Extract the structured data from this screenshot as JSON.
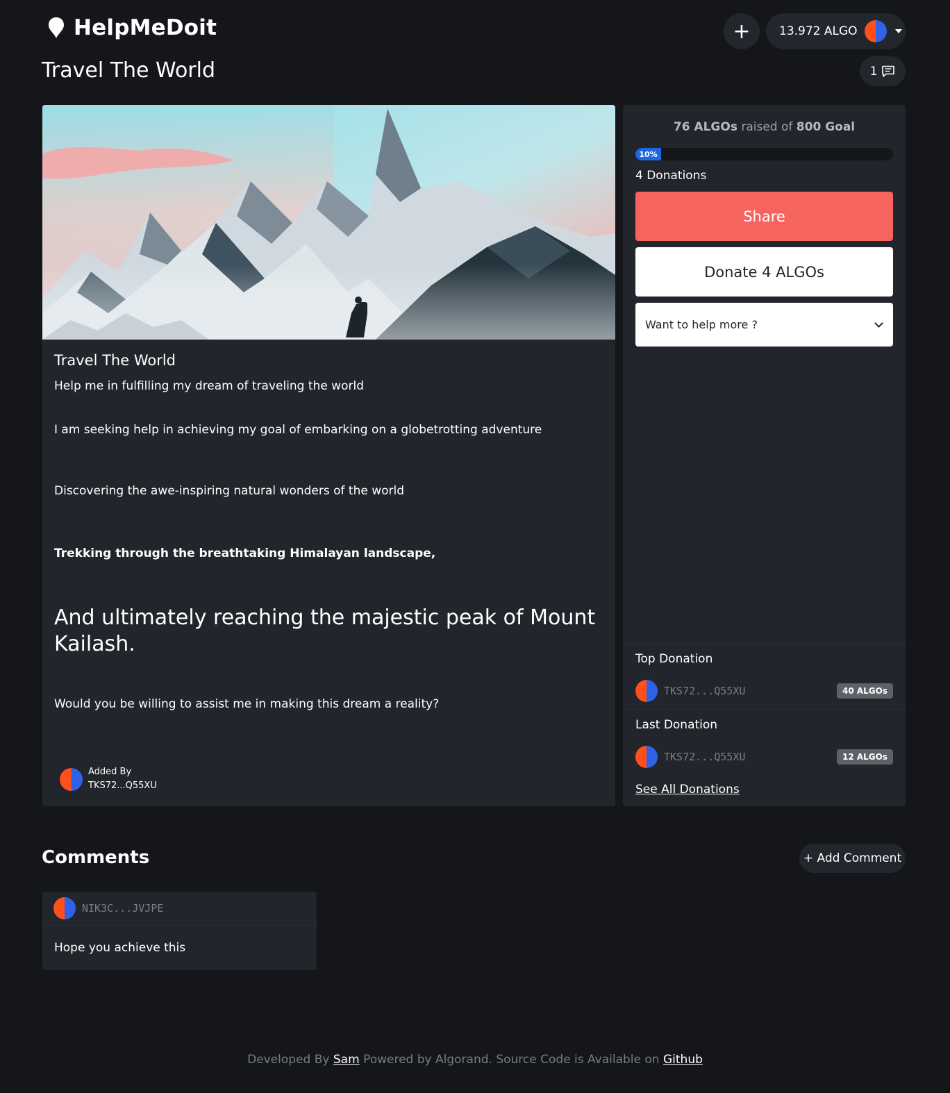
{
  "header": {
    "brand": "HelpMeDoit",
    "create_label": "+",
    "wallet_balance": "13.972 ALGO",
    "comment_count": "1"
  },
  "page": {
    "title": "Travel The World"
  },
  "campaign": {
    "title": "Travel The World",
    "paragraphs": [
      "Help me in fulfilling my dream of traveling the world",
      "I am seeking help in achieving my goal of embarking on a globetrotting adventure",
      "Discovering the awe-inspiring natural wonders of the world",
      "Trekking through the breathtaking Himalayan landscape,",
      "And ultimately reaching the majestic peak of Mount Kailash.",
      "Would you be willing to assist me in making this dream a reality?"
    ],
    "added_by_label": "Added By",
    "added_by_address": "TKS72...Q55XU"
  },
  "funding": {
    "raised_amount": "76 ALGOs",
    "raised_text": "raised of",
    "goal": "800 Goal",
    "progress_label": "10%",
    "progress_fraction": 0.1,
    "donations_count": "4 Donations",
    "share_label": "Share",
    "donate_label": "Donate 4 ALGOs",
    "help_more_placeholder": "Want to help more ?",
    "top_donation": {
      "label": "Top Donation",
      "address": "TKS72...Q55XU",
      "amount": "40 ALGOs"
    },
    "last_donation": {
      "label": "Last Donation",
      "address": "TKS72...Q55XU",
      "amount": "12 ALGOs"
    },
    "see_all_label": "See All Donations"
  },
  "comments": {
    "title": "Comments",
    "add_label": "+ Add Comment",
    "items": [
      {
        "address": "NIK3C...JVJPE",
        "text": "Hope you achieve this"
      }
    ]
  },
  "footer": {
    "developed_by": "Developed By",
    "author": "Sam",
    "middle": "Powered by Algorand. Source Code is Available on",
    "github": "Github"
  },
  "colors": {
    "background": "#14161a",
    "card": "#22252b",
    "share": "#f7645e",
    "progress": "#1d66e6",
    "avatar_left": "#ff4f1a",
    "avatar_right": "#2f62e6"
  },
  "icons": {
    "brand": "map-pin-icon",
    "comments": "chat-bubble-icon",
    "wallet_menu": "caret-down-icon",
    "select": "chevron-down-icon"
  }
}
